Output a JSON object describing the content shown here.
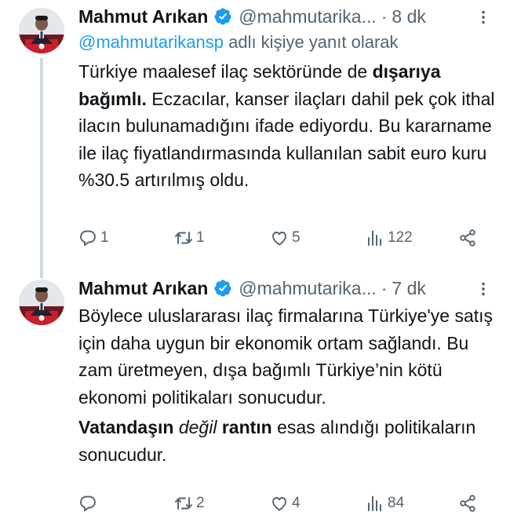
{
  "tweets": [
    {
      "name": "Mahmut Arıkan",
      "handle": "@mahmutarika...",
      "dot": "·",
      "time": "8 dk",
      "reply_to_mention": "@mahmutarikansp",
      "reply_to_suffix": "adlı kişiye yanıt olarak",
      "text_plain_1": "Türkiye maalesef ilaç sektöründe de ",
      "text_bold_1": "dışarıya bağımlı.",
      "text_plain_2": " Eczacılar, kanser ilaçları dahil pek çok ithal ilacın bulunamadığını ifade ediyordu. Bu kararname ile ilaç fiyatlandırmasında kullanılan sabit euro kuru %30.5 artırılmış oldu.",
      "replies": "1",
      "retweets": "1",
      "likes": "5",
      "views": "122"
    },
    {
      "name": "Mahmut Arıkan",
      "handle": "@mahmutarika...",
      "dot": "·",
      "time": "7 dk",
      "text_plain_1": "Böylece uluslararası ilaç firmalarına Türkiye'ye satış için daha uygun bir ekonomik ortam sağlandı. Bu zam üretmeyen, dışa bağımlı Türkiye’nin kötü ekonomi politikaları sonucudur.",
      "text_bold_1": "Vatandaşın",
      "text_italic_1": "değil",
      "text_bold_2": "rantın",
      "text_plain_2": " esas alındığı politikaların sonucudur.",
      "replies": "",
      "retweets": "2",
      "likes": "4",
      "views": "84"
    }
  ],
  "colors": {
    "text": "#0f1419",
    "secondary": "#536471",
    "link": "#1d9bf0",
    "verified": "#1d9bf0",
    "thread_line": "#cfd9de"
  },
  "icons": [
    "more-icon",
    "verified-badge-icon",
    "reply-icon",
    "retweet-icon",
    "like-icon",
    "views-icon",
    "share-icon"
  ]
}
